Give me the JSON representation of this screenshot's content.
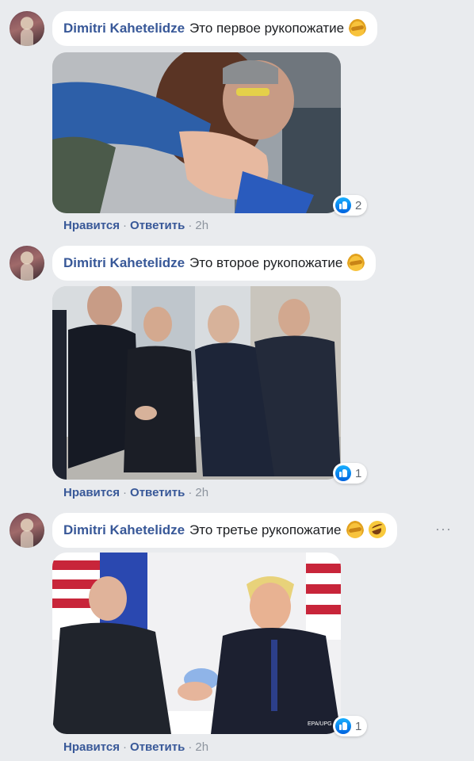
{
  "comments": [
    {
      "author": "Dimitri Kahetelidze",
      "text": "Это первое рукопожатие",
      "emojis": [
        "handshake-icon"
      ],
      "reaction_count": "2",
      "photo_subject": "",
      "actions": {
        "like": "Нравится",
        "reply": "Ответить",
        "time": "2h"
      }
    },
    {
      "author": "Dimitri Kahetelidze",
      "text": "Это второе рукопожатие",
      "emojis": [
        "handshake-icon"
      ],
      "reaction_count": "1",
      "photo_subject": "",
      "actions": {
        "like": "Нравится",
        "reply": "Ответить",
        "time": "2h"
      }
    },
    {
      "author": "Dimitri Kahetelidze",
      "text": "Это третье рукопожатие",
      "emojis": [
        "handshake-icon",
        "rofl-icon"
      ],
      "reaction_count": "1",
      "photo_watermark": "EPA/UPG",
      "actions": {
        "like": "Нравится",
        "reply": "Ответить",
        "time": "2h"
      }
    }
  ],
  "colors": {
    "background": "#e9ebee",
    "author": "#385898",
    "like_blue": "#0062df"
  }
}
